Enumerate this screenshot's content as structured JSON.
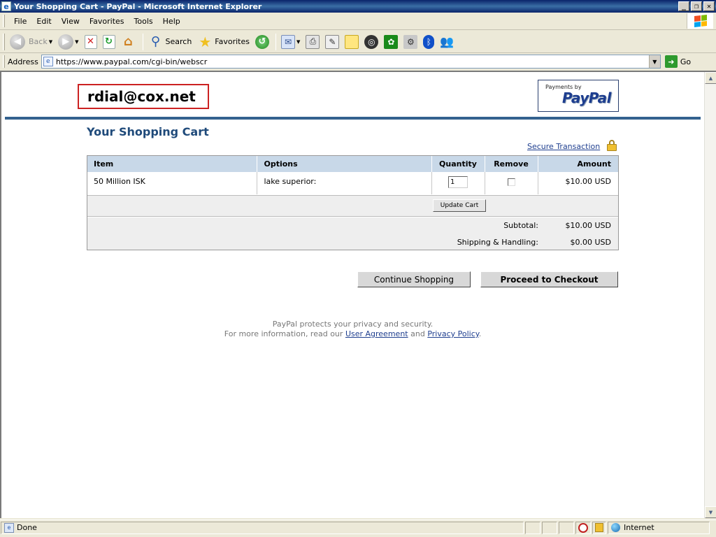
{
  "window": {
    "title": "Your Shopping Cart - PayPal - Microsoft Internet Explorer",
    "minimize_glyph": "_",
    "restore_glyph": "❐",
    "close_glyph": "✕"
  },
  "menu": {
    "items": [
      "File",
      "Edit",
      "View",
      "Favorites",
      "Tools",
      "Help"
    ]
  },
  "toolbar": {
    "back_label": "Back",
    "search_label": "Search",
    "favorites_label": "Favorites"
  },
  "address": {
    "label": "Address",
    "url": "https://www.paypal.com/cgi-bin/webscr",
    "go_label": "Go"
  },
  "page": {
    "email": "rdial@cox.net",
    "paypal_badge": {
      "small_text": "Payments by",
      "logo_text": "PayPal"
    },
    "heading": "Your Shopping Cart",
    "secure_link": "Secure Transaction",
    "cart": {
      "columns": [
        "Item",
        "Options",
        "Quantity",
        "Remove",
        "Amount"
      ],
      "rows": [
        {
          "item": "50 Million ISK",
          "options": "lake superior:",
          "quantity": "1",
          "remove_checked": false,
          "amount": "$10.00 USD"
        }
      ],
      "update_button": "Update Cart",
      "subtotal_label": "Subtotal:",
      "subtotal_value": "$10.00 USD",
      "shipping_label": "Shipping & Handling:",
      "shipping_value": "$0.00 USD"
    },
    "buttons": {
      "continue": "Continue Shopping",
      "checkout": "Proceed to Checkout"
    },
    "footer": {
      "line1": "PayPal protects your privacy and security.",
      "line2_prefix": "For more information, read our",
      "user_agreement": "User Agreement",
      "and": "and",
      "privacy_policy": "Privacy Policy",
      "period": "."
    }
  },
  "status": {
    "text": "Done",
    "zone": "Internet"
  },
  "colors": {
    "accent_rule": "#34628f",
    "heading": "#1f4a7a",
    "table_header": "#c8d8e8",
    "highlight_box": "#cc2222"
  }
}
